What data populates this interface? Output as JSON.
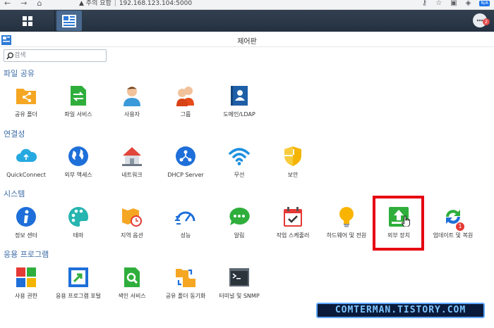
{
  "browser": {
    "security_label": "주의 요함",
    "url": "192.168.123.104:5000",
    "extension_badge": "N/A"
  },
  "taskbar": {
    "notification_count": "2"
  },
  "window": {
    "title": "제어판"
  },
  "search": {
    "placeholder": "검색"
  },
  "sections": [
    {
      "title": "파일 공유",
      "items": [
        "공유 폴더",
        "파일 서비스",
        "사용자",
        "그룹",
        "도메인/LDAP"
      ]
    },
    {
      "title": "연결성",
      "items": [
        "QuickConnect",
        "외부 액세스",
        "네트워크",
        "DHCP Server",
        "무선",
        "보안"
      ]
    },
    {
      "title": "시스템",
      "items": [
        "정보 센터",
        "테마",
        "지역 옵션",
        "성능",
        "알림",
        "작업 스케줄러",
        "하드웨어 및 전원",
        "외부 장치",
        "업데이트 및 복원"
      ]
    },
    {
      "title": "응용 프로그램",
      "items": [
        "사용 권한",
        "응용 프로그램 포털",
        "색인 서비스",
        "공유 폴더 동기화",
        "터미널 및 SNMP"
      ]
    }
  ],
  "update_badge": "1",
  "watermark": "COMTERMAN.TISTORY.COM",
  "colors": {
    "section_title": "#3b6ba5",
    "highlight": "#e60012",
    "taskbar": "#2b3848"
  }
}
